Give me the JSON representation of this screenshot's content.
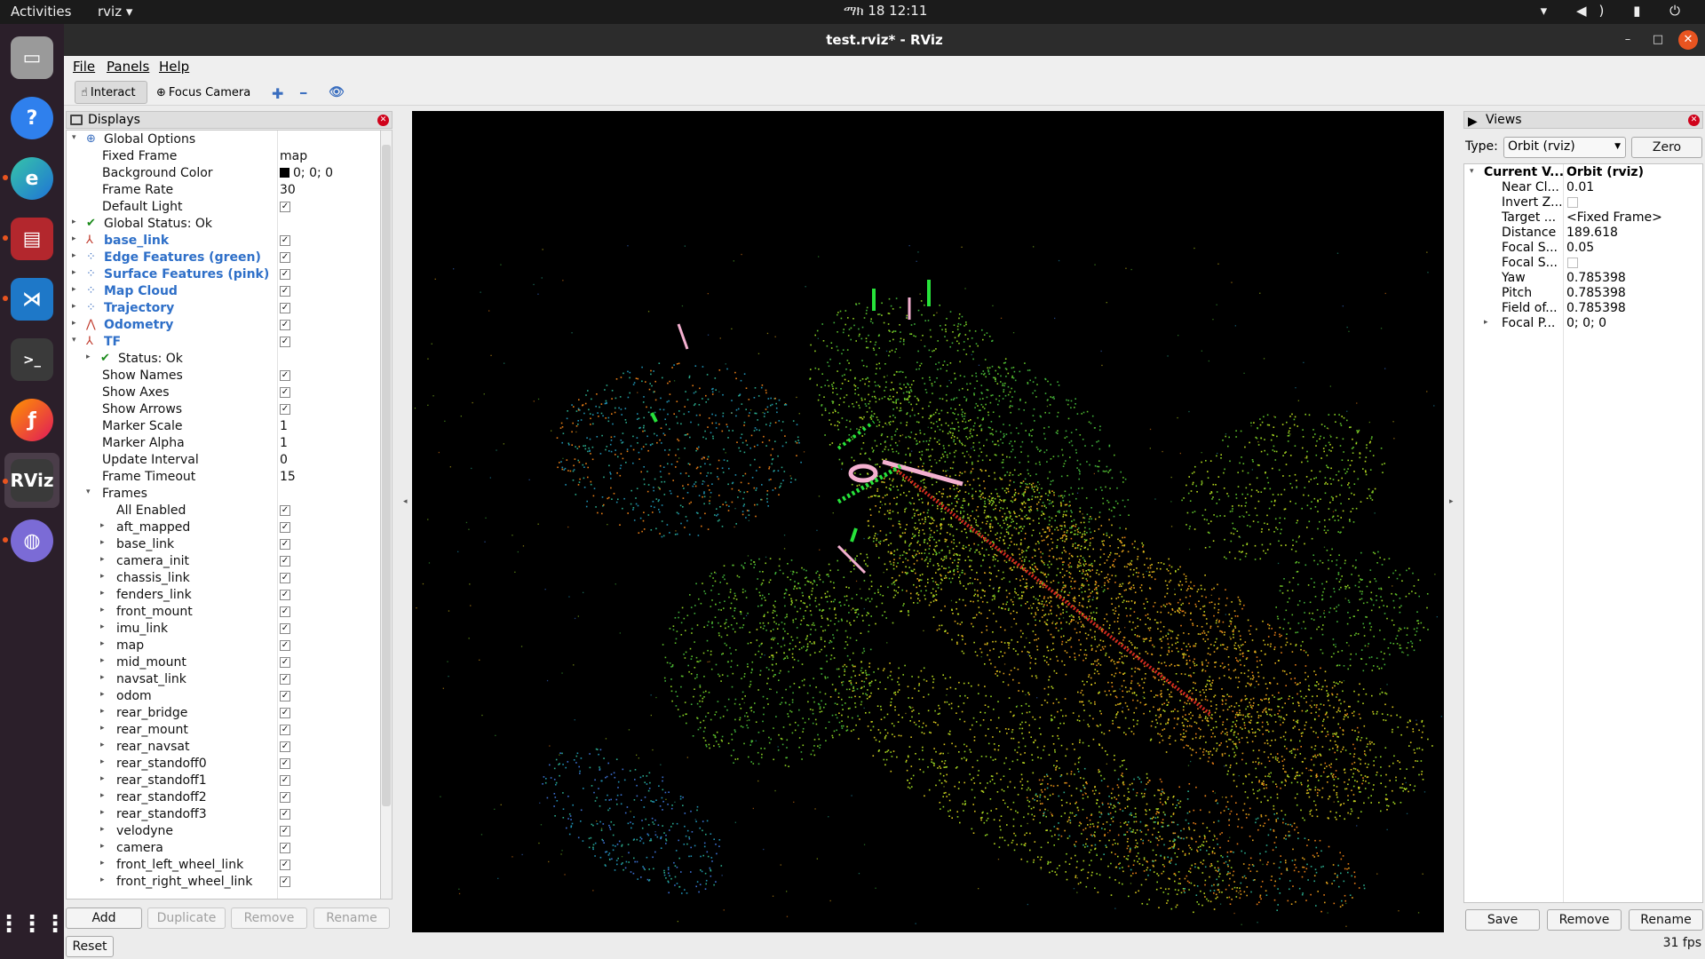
{
  "topbar": {
    "activities": "Activities",
    "app": "rviz ▾",
    "clock": "ማክ 18 12:11",
    "tray": "▾ ◀) ▮ ⏻"
  },
  "window": {
    "title": "test.rviz* - RViz",
    "min": "–",
    "max": "□",
    "close": "✕"
  },
  "menu": {
    "file": "File",
    "panels": "Panels",
    "help": "Help"
  },
  "toolbar": {
    "interact": "Interact",
    "focus_camera": "Focus Camera",
    "plus": "✚",
    "minus": "━",
    "eye": "👁"
  },
  "displays_panel": {
    "title": "Displays",
    "close": "✕",
    "rows": [
      {
        "arrow": "▾",
        "name": "Global Options",
        "depth": 0,
        "icon": "globe-icon",
        "glyph": "⊕",
        "color": "#3a6ebf"
      },
      {
        "name": "Fixed Frame",
        "depth": 1,
        "value": "map"
      },
      {
        "name": "Background Color",
        "depth": 1,
        "value": "0; 0; 0",
        "swatch": true
      },
      {
        "name": "Frame Rate",
        "depth": 1,
        "value": "30"
      },
      {
        "name": "Default Light",
        "depth": 1,
        "check": true
      },
      {
        "arrow": "▸",
        "name": "Global Status: Ok",
        "depth": 0,
        "icon": "checkmark-icon",
        "glyph": "✔",
        "color": "#1a8a1a"
      },
      {
        "arrow": "▸",
        "name": "base_link",
        "depth": 0,
        "icon": "axes-icon",
        "glyph": "⅄",
        "color": "#c0392b",
        "blue": true,
        "check": true
      },
      {
        "arrow": "▸",
        "name": "Edge Features (green)",
        "depth": 0,
        "icon": "pointcloud-icon",
        "glyph": "⁘",
        "color": "#3a6ebf",
        "blue": true,
        "check": true
      },
      {
        "arrow": "▸",
        "name": "Surface Features (pink)",
        "depth": 0,
        "icon": "pointcloud-icon",
        "glyph": "⁘",
        "color": "#3a6ebf",
        "blue": true,
        "check": true
      },
      {
        "arrow": "▸",
        "name": "Map Cloud",
        "depth": 0,
        "icon": "pointcloud-icon",
        "glyph": "⁘",
        "color": "#3a6ebf",
        "blue": true,
        "check": true
      },
      {
        "arrow": "▸",
        "name": "Trajectory",
        "depth": 0,
        "icon": "pointcloud-icon",
        "glyph": "⁘",
        "color": "#3a6ebf",
        "blue": true,
        "check": true
      },
      {
        "arrow": "▸",
        "name": "Odometry",
        "depth": 0,
        "icon": "odometry-icon",
        "glyph": "⋀",
        "color": "#c0392b",
        "blue": true,
        "check": true
      },
      {
        "arrow": "▾",
        "name": "TF",
        "depth": 0,
        "icon": "tf-icon",
        "glyph": "⅄",
        "color": "#c0392b",
        "blue": true,
        "check": true
      },
      {
        "arrow": "▸",
        "name": "Status: Ok",
        "depth": 1,
        "icon": "checkmark-icon",
        "glyph": "✔",
        "color": "#1a8a1a"
      },
      {
        "name": "Show Names",
        "depth": 1,
        "check": true
      },
      {
        "name": "Show Axes",
        "depth": 1,
        "check": true
      },
      {
        "name": "Show Arrows",
        "depth": 1,
        "check": true
      },
      {
        "name": "Marker Scale",
        "depth": 1,
        "value": "1"
      },
      {
        "name": "Marker Alpha",
        "depth": 1,
        "value": "1"
      },
      {
        "name": "Update Interval",
        "depth": 1,
        "value": "0"
      },
      {
        "name": "Frame Timeout",
        "depth": 1,
        "value": "15"
      },
      {
        "arrow": "▾",
        "name": "Frames",
        "depth": 1
      },
      {
        "name": "All Enabled",
        "depth": 2,
        "check": true
      },
      {
        "arrow": "▸",
        "name": "aft_mapped",
        "depth": 2,
        "check": true
      },
      {
        "arrow": "▸",
        "name": "base_link",
        "depth": 2,
        "check": true
      },
      {
        "arrow": "▸",
        "name": "camera_init",
        "depth": 2,
        "check": true
      },
      {
        "arrow": "▸",
        "name": "chassis_link",
        "depth": 2,
        "check": true
      },
      {
        "arrow": "▸",
        "name": "fenders_link",
        "depth": 2,
        "check": true
      },
      {
        "arrow": "▸",
        "name": "front_mount",
        "depth": 2,
        "check": true
      },
      {
        "arrow": "▸",
        "name": "imu_link",
        "depth": 2,
        "check": true
      },
      {
        "arrow": "▸",
        "name": "map",
        "depth": 2,
        "check": true
      },
      {
        "arrow": "▸",
        "name": "mid_mount",
        "depth": 2,
        "check": true
      },
      {
        "arrow": "▸",
        "name": "navsat_link",
        "depth": 2,
        "check": true
      },
      {
        "arrow": "▸",
        "name": "odom",
        "depth": 2,
        "check": true
      },
      {
        "arrow": "▸",
        "name": "rear_bridge",
        "depth": 2,
        "check": true
      },
      {
        "arrow": "▸",
        "name": "rear_mount",
        "depth": 2,
        "check": true
      },
      {
        "arrow": "▸",
        "name": "rear_navsat",
        "depth": 2,
        "check": true
      },
      {
        "arrow": "▸",
        "name": "rear_standoff0",
        "depth": 2,
        "check": true
      },
      {
        "arrow": "▸",
        "name": "rear_standoff1",
        "depth": 2,
        "check": true
      },
      {
        "arrow": "▸",
        "name": "rear_standoff2",
        "depth": 2,
        "check": true
      },
      {
        "arrow": "▸",
        "name": "rear_standoff3",
        "depth": 2,
        "check": true
      },
      {
        "arrow": "▸",
        "name": "velodyne",
        "depth": 2,
        "check": true
      },
      {
        "arrow": "▸",
        "name": "camera",
        "depth": 2,
        "check": true
      },
      {
        "arrow": "▸",
        "name": "front_left_wheel_link",
        "depth": 2,
        "check": true
      },
      {
        "arrow": "▸",
        "name": "front_right_wheel_link",
        "depth": 2,
        "check": true
      }
    ],
    "buttons": {
      "add": "Add",
      "duplicate": "Duplicate",
      "remove": "Remove",
      "rename": "Rename",
      "reset": "Reset"
    }
  },
  "views_panel": {
    "title": "Views",
    "close": "✕",
    "type_label": "Type:",
    "type_value": "Orbit (rviz)",
    "zero": "Zero",
    "rows": [
      {
        "arrow": "▾",
        "name": "Current V...",
        "value": "Orbit (rviz)",
        "bold": true,
        "depth": 0
      },
      {
        "name": "Near Cl...",
        "value": "0.01",
        "depth": 1
      },
      {
        "name": "Invert Z...",
        "check": false,
        "depth": 1
      },
      {
        "name": "Target ...",
        "value": "<Fixed Frame>",
        "depth": 1
      },
      {
        "name": "Distance",
        "value": "189.618",
        "depth": 1
      },
      {
        "name": "Focal S...",
        "value": "0.05",
        "depth": 1
      },
      {
        "name": "Focal S...",
        "check": false,
        "depth": 1
      },
      {
        "name": "Yaw",
        "value": "0.785398",
        "depth": 1
      },
      {
        "name": "Pitch",
        "value": "0.785398",
        "depth": 1
      },
      {
        "name": "Field of...",
        "value": "0.785398",
        "depth": 1
      },
      {
        "arrow": "▸",
        "name": "Focal P...",
        "value": "0; 0; 0",
        "depth": 1
      }
    ],
    "buttons": {
      "save": "Save",
      "remove": "Remove",
      "rename": "Rename"
    }
  },
  "status": {
    "fps": "31 fps"
  },
  "colors": {
    "accent": "#e95420",
    "link_blue": "#2e6fc8",
    "viewport_bg": "#000000"
  }
}
